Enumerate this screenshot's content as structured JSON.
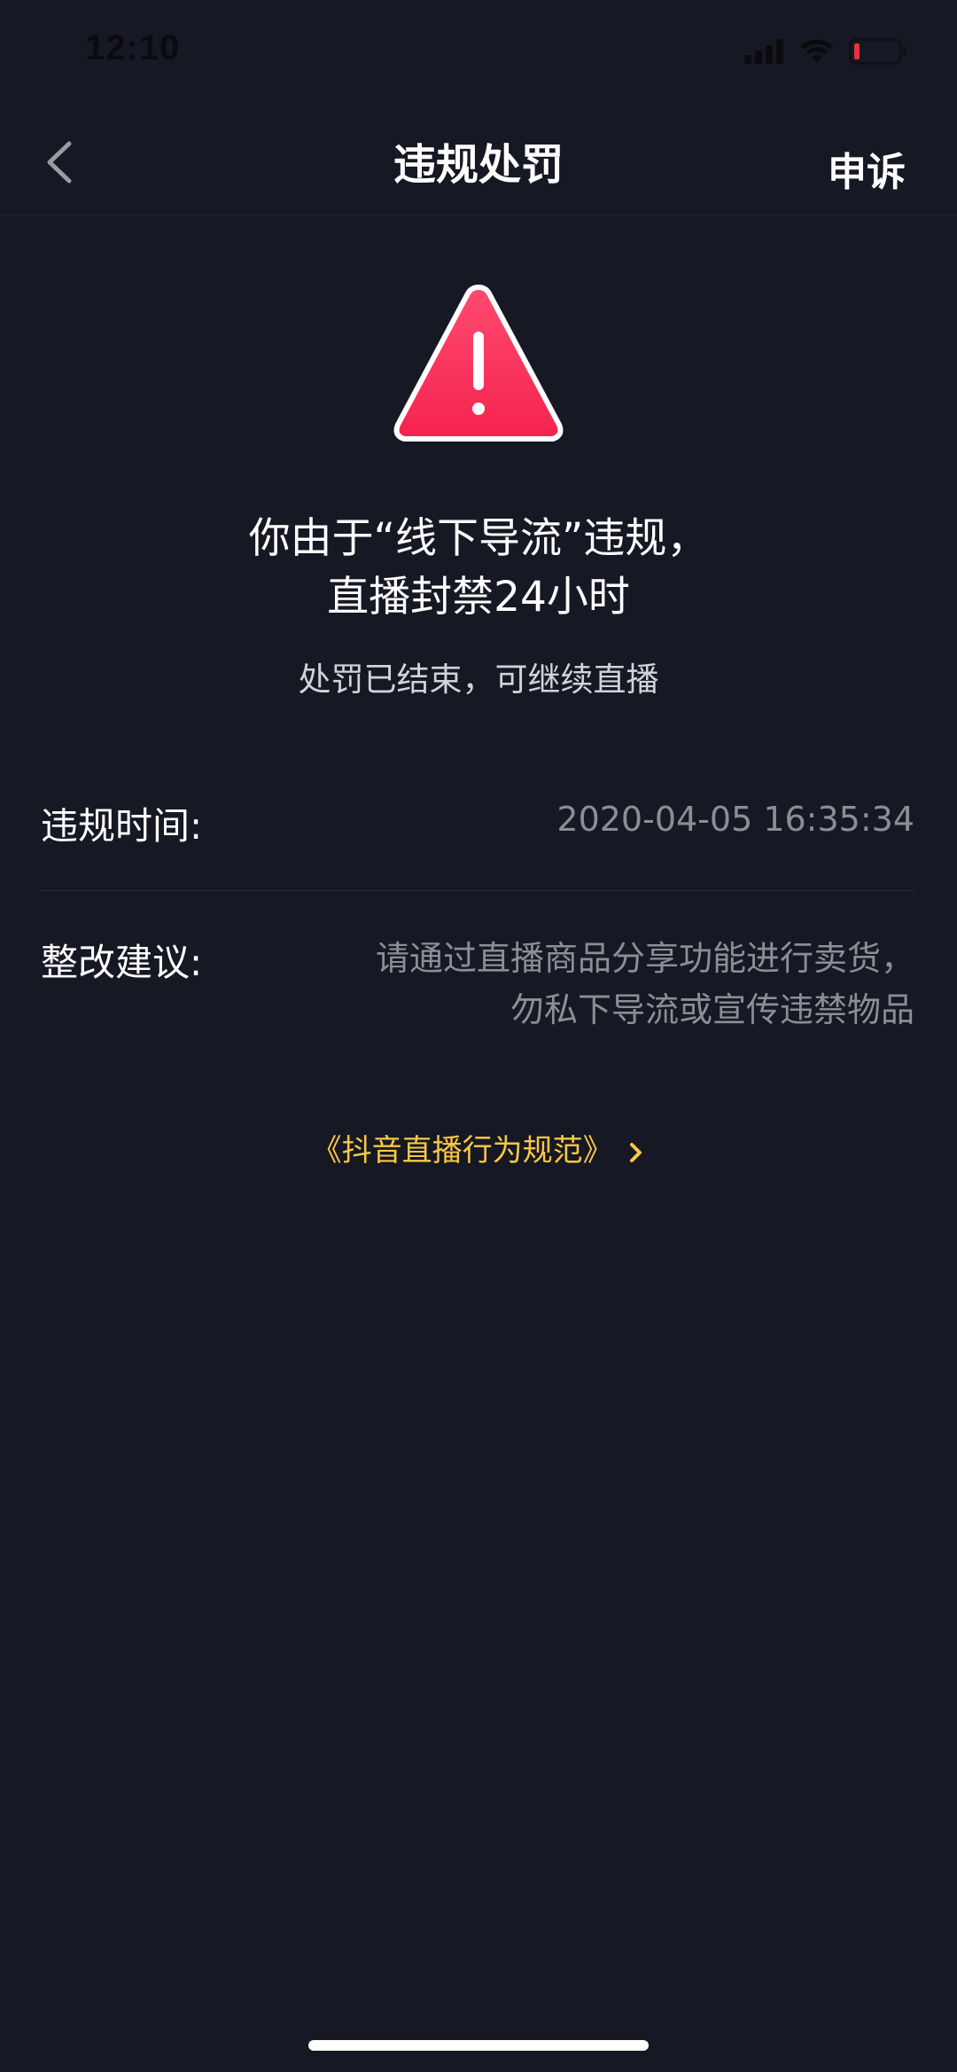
{
  "status_bar": {
    "time": "12:10"
  },
  "nav": {
    "title": "违规处罚",
    "appeal_label": "申诉"
  },
  "notice": {
    "headline_line1": "你由于“线下导流”违规，",
    "headline_line2": "直播封禁24小时",
    "sub_status": "处罚已结束，可继续直播"
  },
  "details": {
    "time_label": "违规时间:",
    "time_value": "2020-04-05 16:35:34",
    "suggest_label": "整改建议:",
    "suggest_value": "请通过直播商品分享功能进行卖货，勿私下导流或宣传违禁物品"
  },
  "rules_link": {
    "label": "《抖音直播行为规范》"
  },
  "colors": {
    "background": "#161823",
    "warning": "#fe2c55",
    "link": "#f7c843",
    "muted_text": "#8b8d97"
  }
}
